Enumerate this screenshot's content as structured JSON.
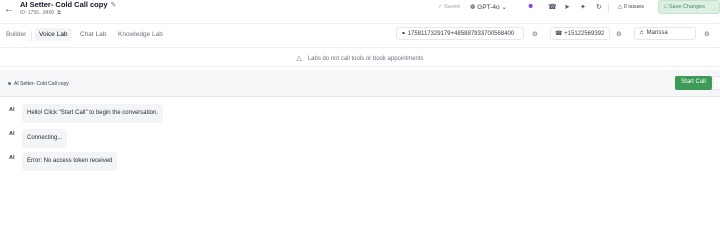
{
  "header": {
    "back_icon": "arrow-left-icon",
    "title": "AI Setter- Cold Call  copy",
    "edit_icon": "pencil-icon",
    "id_label": "ID: 1756...8400",
    "copy_icon": "copy-icon",
    "saved_label": "Saved",
    "model": "GPT-4o",
    "issues": "0 issues",
    "save_label": "Save Changes"
  },
  "tabs": [
    {
      "label": "Builder"
    },
    {
      "label": "Voice Lab",
      "active": true
    },
    {
      "label": "Chat Lab"
    },
    {
      "label": "Knowledge Lab"
    }
  ],
  "config": {
    "phone_id": "1758117329179+485887933700568400",
    "phone_number": "+15122569392",
    "voice": "Marissa"
  },
  "notice": "Labs do not call tools or book appointments",
  "agent_bar": {
    "agent_name": "AI Setter- Cold Call copy",
    "start_label": "Start Call"
  },
  "messages": [
    {
      "sender": "AI",
      "text": "Hello! Click \"Start Call\" to begin the conversation."
    },
    {
      "sender": "AI",
      "text": "Connecting..."
    },
    {
      "sender": "AI",
      "text": "Error: No access token received"
    }
  ],
  "colors": {
    "accent_green": "#3e9b57",
    "save_button_bg": "#dcefe0",
    "user_icon": "#7c3aed"
  }
}
